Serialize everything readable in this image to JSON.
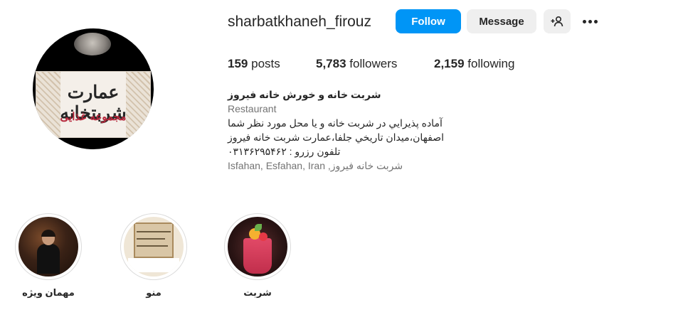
{
  "profile": {
    "username": "sharbatkhaneh_firouz",
    "avatar_text": "عمارت شربتخانه",
    "avatar_subtext": "مجموعه غذایی"
  },
  "actions": {
    "follow_label": "Follow",
    "message_label": "Message",
    "suggest_icon": "person-add-icon",
    "more_icon": "more-options-icon"
  },
  "stats": {
    "posts_count": "159",
    "posts_label": "posts",
    "followers_count": "5,783",
    "followers_label": "followers",
    "following_count": "2,159",
    "following_label": "following"
  },
  "bio": {
    "name": "شربت خانه و خورش خانه فیروز",
    "category": "Restaurant",
    "lines": [
      "آماده پذيرايي در شربت خانه و يا محل مورد نظر شما",
      "اصفهان،ميدان تاريخي جلفا،عمارت شربت خانه فيروز",
      "تلفون رزرو : ۰۳۱۳۶۲۹۵۴۶۲"
    ],
    "location": "Isfahan, Esfahan, Iran ,شربت خانه فیروز"
  },
  "highlights": [
    {
      "label": "مهمان ویژه"
    },
    {
      "label": "منو"
    },
    {
      "label": "شربت"
    }
  ],
  "colors": {
    "primary": "#0095f6",
    "secondary_bg": "#efefef",
    "muted_text": "#737373"
  }
}
